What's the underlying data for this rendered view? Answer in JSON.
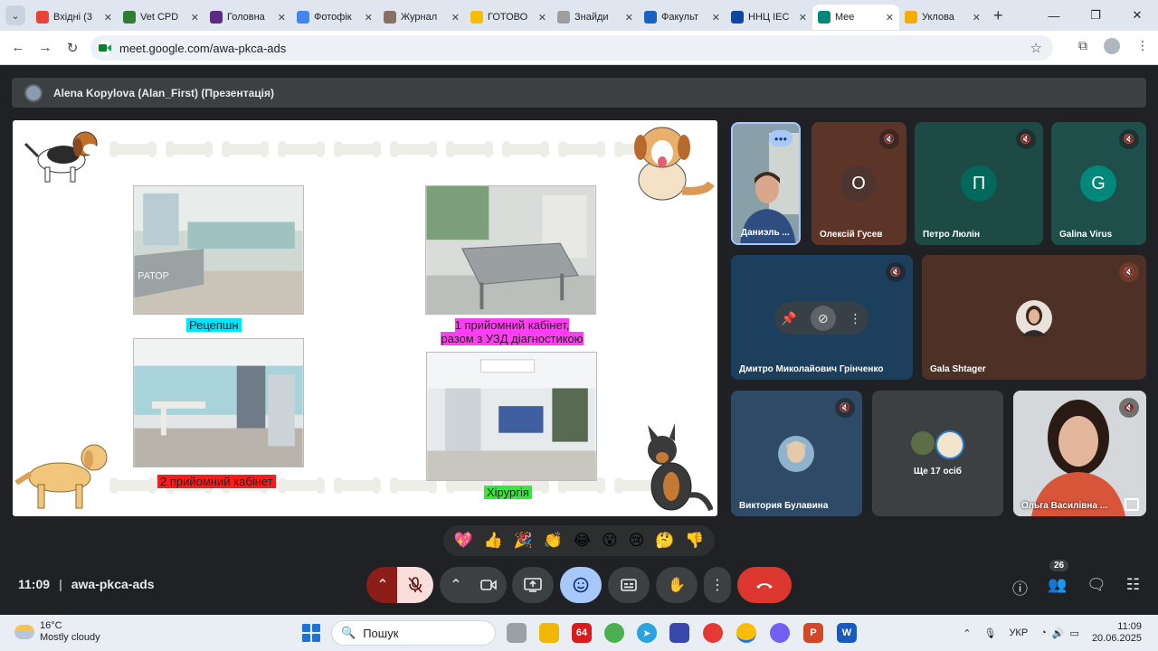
{
  "browser": {
    "tabs": [
      {
        "title": "Вхідні (3",
        "fav_color": "#ea4335"
      },
      {
        "title": "Vet CPD",
        "fav_color": "#2e7d32"
      },
      {
        "title": "Головна",
        "fav_color": "#5b2a86"
      },
      {
        "title": "Фотофік",
        "fav_color": "#4285f4"
      },
      {
        "title": "Журнал",
        "fav_color": "#8d6e63"
      },
      {
        "title": "ГОТОВО",
        "fav_color": "#fbbc04"
      },
      {
        "title": "Знайди",
        "fav_color": "#9e9e9e"
      },
      {
        "title": "Факульт",
        "fav_color": "#1565c0"
      },
      {
        "title": "ННЦ ІЕС",
        "fav_color": "#0d47a1"
      },
      {
        "title": "Mee",
        "fav_color": "#00897b"
      },
      {
        "title": "Уклова",
        "fav_color": "#f9ab00"
      }
    ],
    "active_tab_index": 9,
    "url": "meet.google.com/awa-pkca-ads"
  },
  "meeting": {
    "presenter_label": "Alena Kopylova (Alan_First) (Презентація)",
    "time": "11:09",
    "code": "awa-pkca-ads",
    "participant_count": "26",
    "reactions": [
      "💖",
      "👍",
      "🎉",
      "👏",
      "😂",
      "😮",
      "😢",
      "🤔",
      "👎"
    ]
  },
  "slide": {
    "captions": {
      "reception": "Рецепшн",
      "room1": "1 прийомний кабінет, разом з УЗД діагностикою",
      "room2": "2 прийомний кабінет",
      "surgery": "Хірургія"
    },
    "photo_sign": "РАТОР"
  },
  "participants": [
    {
      "name": "Даниэль ...",
      "initial": "",
      "av_color": ""
    },
    {
      "name": "Олексій Гусев",
      "initial": "О",
      "av_color": "#5d4037"
    },
    {
      "name": "Петро Люлін",
      "initial": "П",
      "av_color": "#00695c"
    },
    {
      "name": "Galina Virus",
      "initial": "G",
      "av_color": "#00897b"
    },
    {
      "name": "Дмитро Миколайович Грінченко",
      "initial": "",
      "av_color": ""
    },
    {
      "name": "Gala Shtager",
      "initial": "",
      "av_color": ""
    },
    {
      "name": "Виктория Булавина",
      "initial": "",
      "av_color": ""
    },
    {
      "name": "Ще 17 осіб",
      "initial": "",
      "av_color": ""
    },
    {
      "name": "Ольга Василівна ...",
      "initial": "",
      "av_color": ""
    }
  ],
  "taskbar": {
    "weather_temp": "16°C",
    "weather_desc": "Mostly cloudy",
    "search_label": "Пошук",
    "lang": "УКР",
    "clock_time": "11:09",
    "clock_date": "20.06.2025"
  }
}
